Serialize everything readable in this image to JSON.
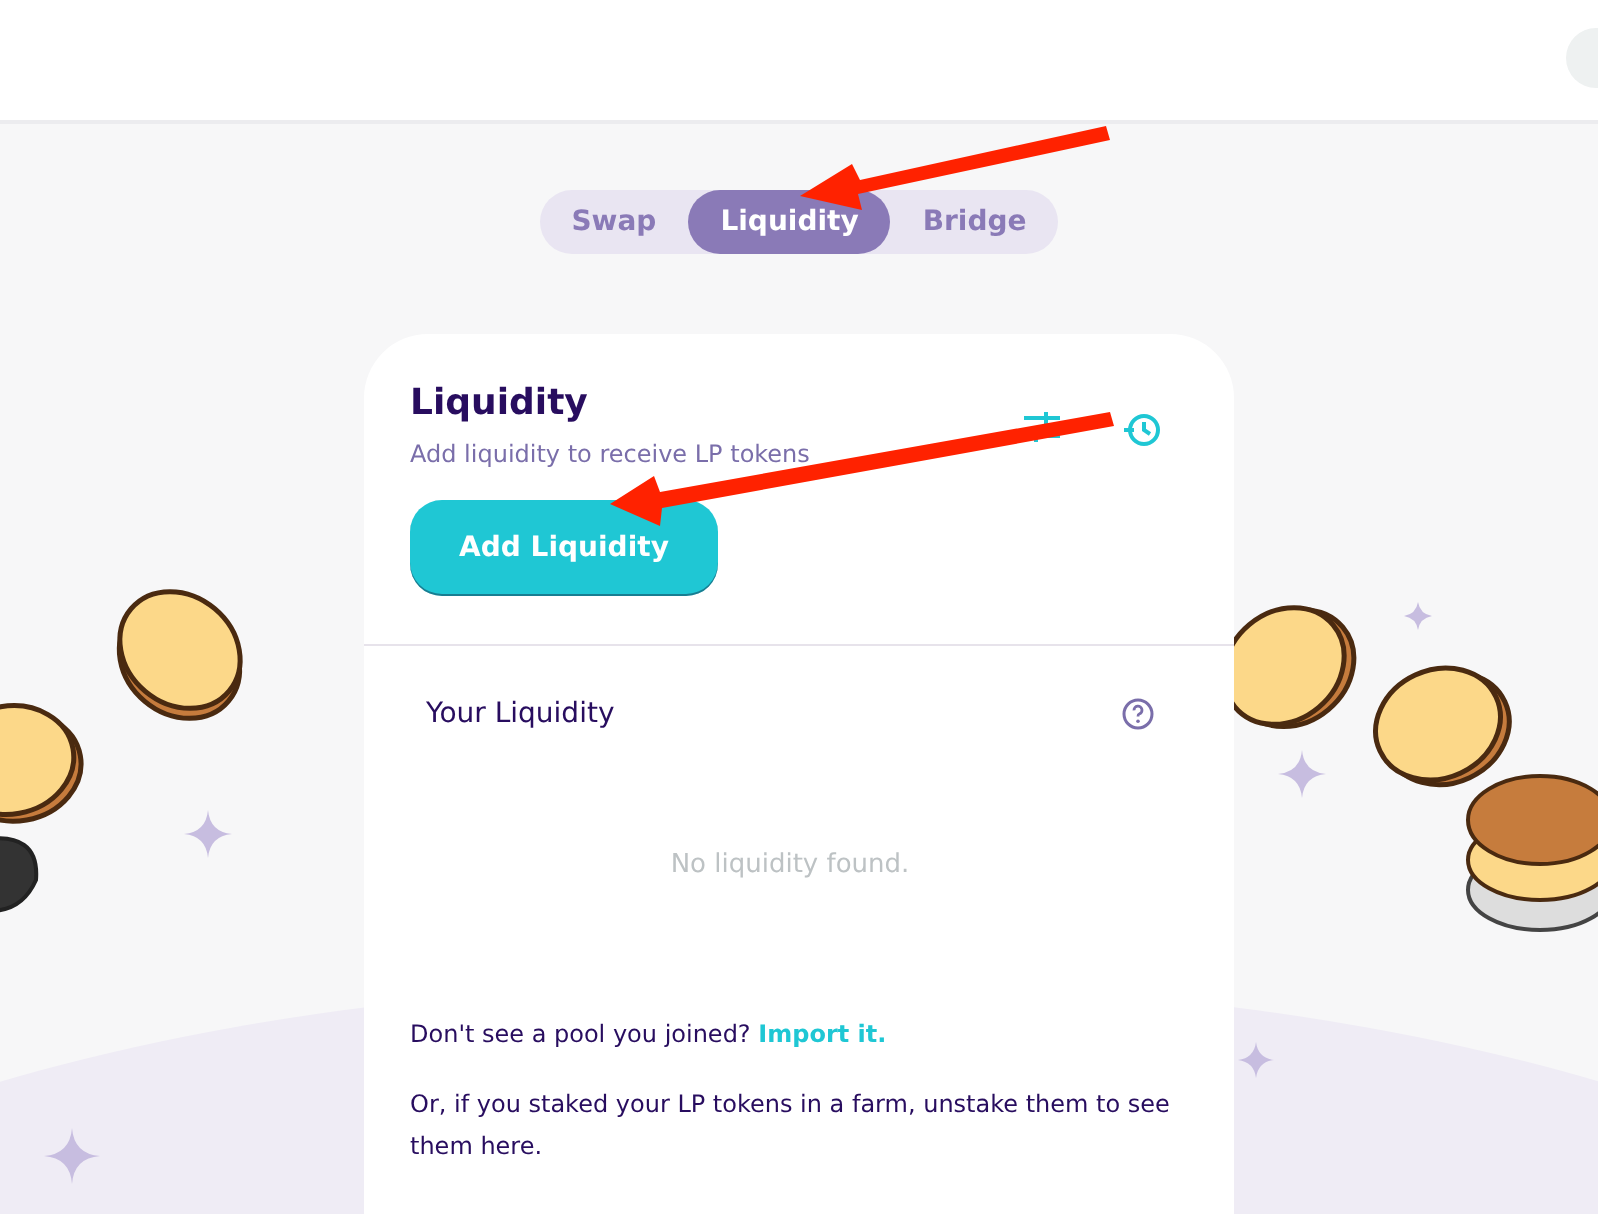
{
  "tabs": [
    {
      "label": "Swap",
      "selected": false
    },
    {
      "label": "Liquidity",
      "selected": true
    },
    {
      "label": "Bridge",
      "selected": false
    }
  ],
  "card": {
    "title": "Liquidity",
    "subtitle": "Add liquidity to receive LP tokens",
    "add_button": "Add Liquidity"
  },
  "your_liquidity": {
    "title": "Your Liquidity",
    "empty_text": "No liquidity found."
  },
  "footer": {
    "import_prompt": "Don't see a pool you joined?",
    "import_link": "Import it.",
    "farm_note": "Or, if you staked your LP tokens in a farm, unstake them to see them here."
  }
}
